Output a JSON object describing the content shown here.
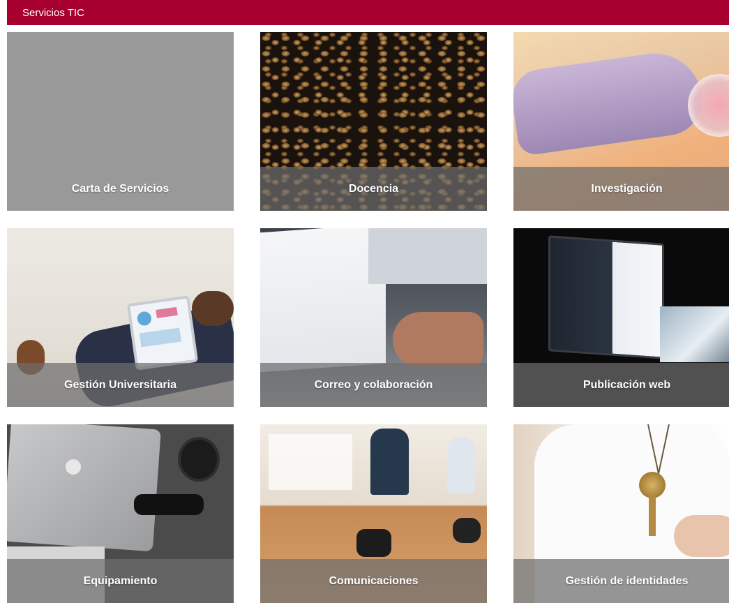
{
  "header": {
    "title": "Servicios TIC"
  },
  "tiles": [
    {
      "label": "Carta de Servicios"
    },
    {
      "label": "Docencia"
    },
    {
      "label": "Investigación"
    },
    {
      "label": "Gestión Universitaria"
    },
    {
      "label": "Correo y colaboración"
    },
    {
      "label": "Publicación web"
    },
    {
      "label": "Equipamiento"
    },
    {
      "label": "Comunicaciones"
    },
    {
      "label": "Gestión de identidades"
    }
  ],
  "colors": {
    "brand": "#a8002e",
    "caption_overlay": "#6e6e6e",
    "plain_tile": "#999999"
  }
}
